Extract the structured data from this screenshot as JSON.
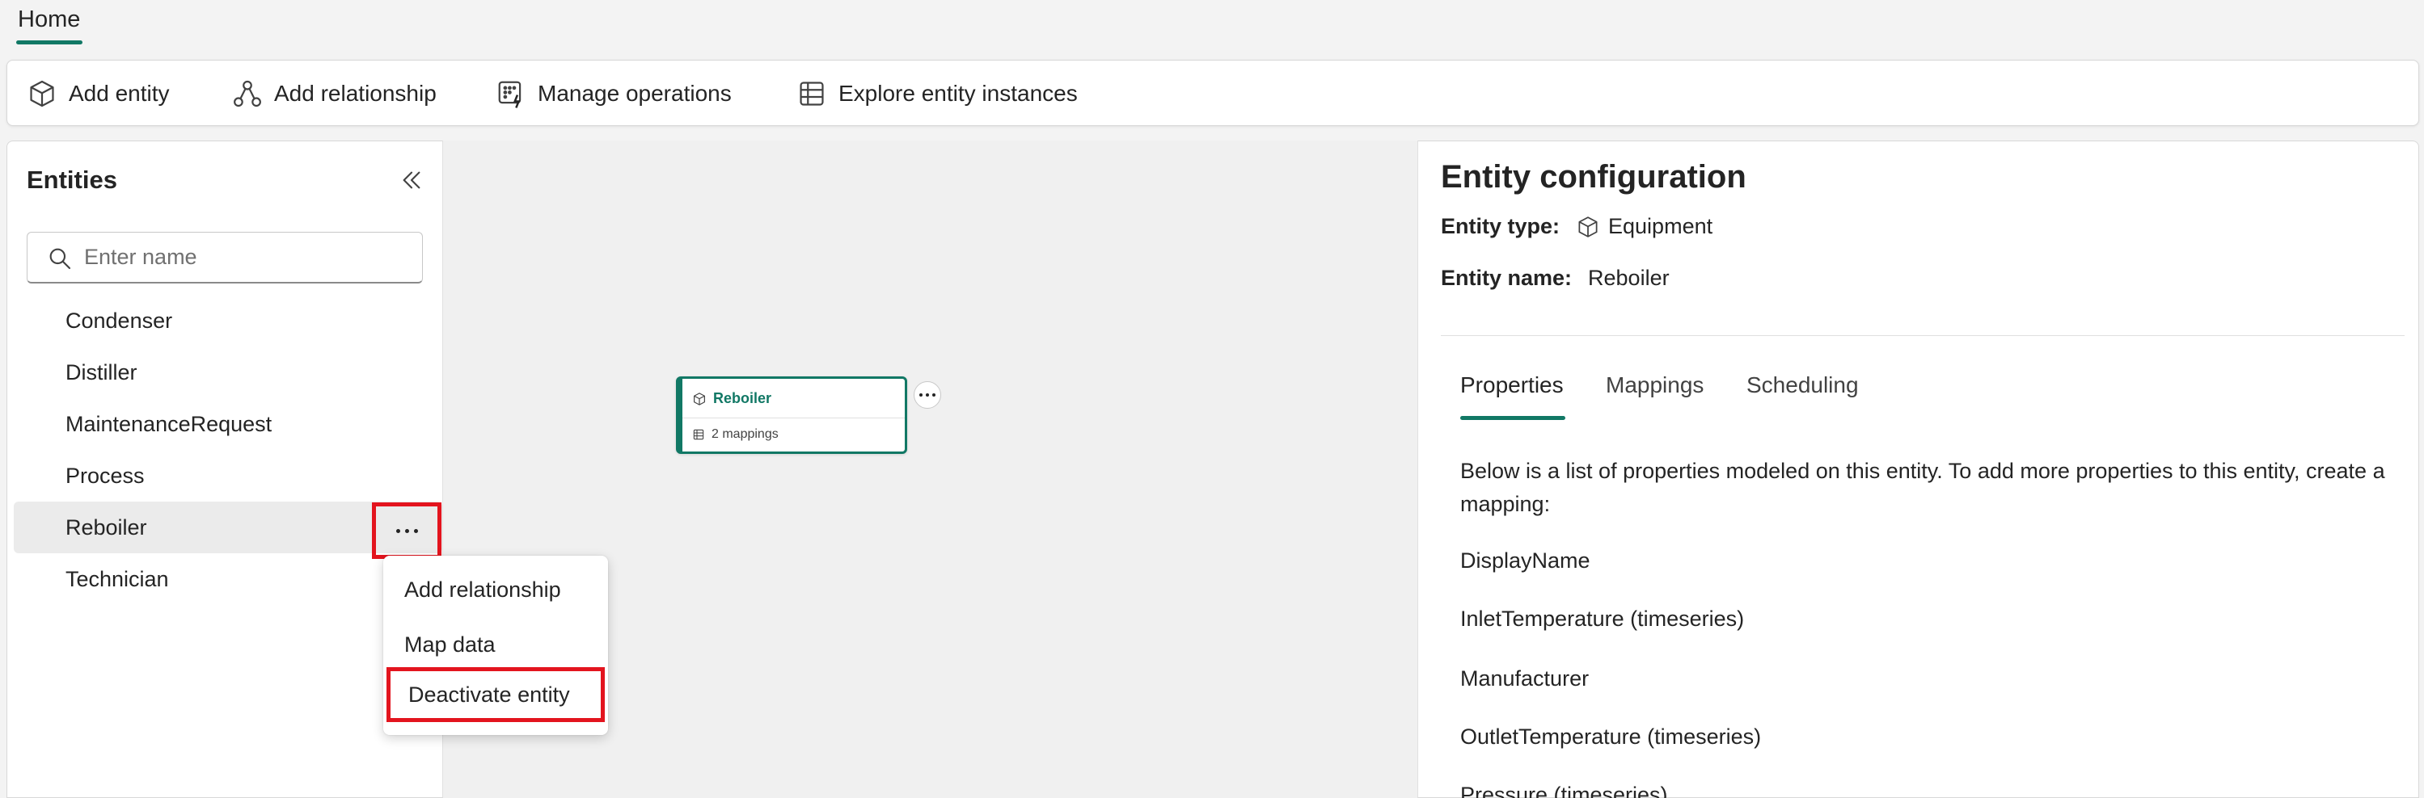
{
  "tabs": {
    "home": "Home"
  },
  "ribbon": {
    "add_entity": "Add entity",
    "add_relationship": "Add relationship",
    "manage_operations": "Manage operations",
    "explore_instances": "Explore entity instances"
  },
  "entities": {
    "title": "Entities",
    "search_placeholder": "Enter name",
    "items": [
      {
        "label": "Condenser"
      },
      {
        "label": "Distiller"
      },
      {
        "label": "MaintenanceRequest"
      },
      {
        "label": "Process"
      },
      {
        "label": "Reboiler"
      },
      {
        "label": "Technician"
      }
    ]
  },
  "context_menu": {
    "items": [
      {
        "label": "Add relationship"
      },
      {
        "label": "Map data"
      },
      {
        "label": "Deactivate entity"
      }
    ]
  },
  "canvas": {
    "node": {
      "title": "Reboiler",
      "subtitle": "2 mappings"
    }
  },
  "config": {
    "title": "Entity configuration",
    "type_label": "Entity type:",
    "type_value": "Equipment",
    "name_label": "Entity name:",
    "name_value": "Reboiler",
    "tabs": [
      {
        "label": "Properties"
      },
      {
        "label": "Mappings"
      },
      {
        "label": "Scheduling"
      }
    ],
    "description": "Below is a list of properties modeled on this entity. To add more properties to this entity, create a mapping:",
    "properties": [
      "DisplayName",
      "InletTemperature (timeseries)",
      "Manufacturer",
      "OutletTemperature (timeseries)",
      "Pressure (timeseries)"
    ]
  },
  "colors": {
    "accent": "#117865",
    "highlight": "#e3141e"
  }
}
